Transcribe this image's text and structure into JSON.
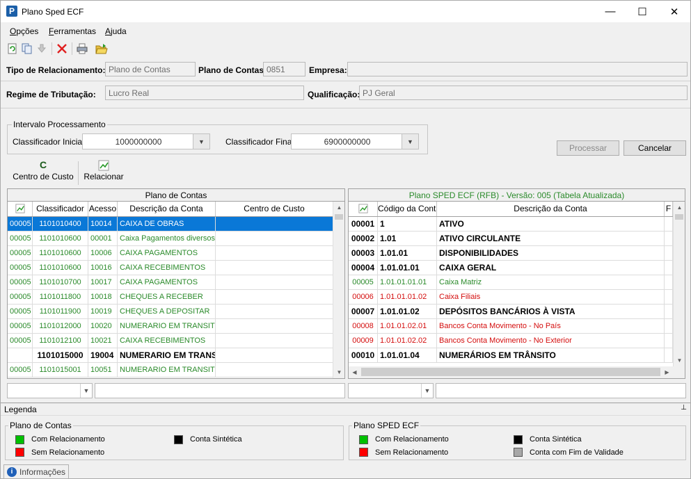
{
  "window": {
    "title": "Plano Sped ECF",
    "app_icon_letter": "P",
    "minimize": "—",
    "maximize": "☐",
    "close": "✕"
  },
  "menu": [
    {
      "label": "Opções",
      "underline": "O",
      "rest": "pções"
    },
    {
      "label": "Ferramentas",
      "underline": "F",
      "rest": "erramentas"
    },
    {
      "label": "Ajuda",
      "underline": "A",
      "rest": "juda"
    }
  ],
  "form": {
    "tipo_label": "Tipo de Relacionamento:",
    "tipo_value": "Plano de Contas",
    "plano_label": "Plano de Contas:",
    "plano_value": "0851",
    "empresa_label": "Empresa:",
    "empresa_value": "",
    "regime_label": "Regime de Tributação:",
    "regime_value": "Lucro Real",
    "qualificacao_label": "Qualificação:",
    "qualificacao_value": "PJ Geral"
  },
  "intervalo": {
    "title": "Intervalo Processamento",
    "inicial_label": "Classificador Inicial:",
    "inicial_value": "1000000000",
    "final_label": "Classificador Final:",
    "final_value": "6900000000"
  },
  "buttons": {
    "processar": "Processar",
    "cancelar": "Cancelar",
    "centro_custo": "Centro de Custo",
    "centro_custo_icon_letter": "C",
    "relacionar": "Relacionar"
  },
  "left_grid": {
    "caption": "Plano de Contas",
    "headers": [
      "",
      "Classificador",
      "Acesso",
      "Descrição da Conta",
      "Centro de Custo"
    ],
    "rows": [
      {
        "style": "sel",
        "code": "00005",
        "classificador": "1101010400",
        "acesso": "10014",
        "descricao": "CAIXA DE OBRAS",
        "centro": ""
      },
      {
        "style": "green",
        "code": "00005",
        "classificador": "1101010600",
        "acesso": "00001",
        "descricao": "Caixa Pagamentos diversos",
        "centro": ""
      },
      {
        "style": "green",
        "code": "00005",
        "classificador": "1101010600",
        "acesso": "10006",
        "descricao": "CAIXA PAGAMENTOS",
        "centro": ""
      },
      {
        "style": "green",
        "code": "00005",
        "classificador": "1101010600",
        "acesso": "10016",
        "descricao": "CAIXA RECEBIMENTOS",
        "centro": ""
      },
      {
        "style": "green",
        "code": "00005",
        "classificador": "1101010700",
        "acesso": "10017",
        "descricao": "CAIXA PAGAMENTOS",
        "centro": ""
      },
      {
        "style": "green",
        "code": "00005",
        "classificador": "1101011800",
        "acesso": "10018",
        "descricao": "CHEQUES A RECEBER",
        "centro": ""
      },
      {
        "style": "green",
        "code": "00005",
        "classificador": "1101011900",
        "acesso": "10019",
        "descricao": "CHEQUES A DEPOSITAR",
        "centro": ""
      },
      {
        "style": "green",
        "code": "00005",
        "classificador": "1101012000",
        "acesso": "10020",
        "descricao": "NUMERARIO EM TRANSITO",
        "centro": ""
      },
      {
        "style": "green",
        "code": "00005",
        "classificador": "1101012100",
        "acesso": "10021",
        "descricao": "CAIXA RECEBIMENTOS",
        "centro": ""
      },
      {
        "style": "bold",
        "code": "",
        "classificador": "1101015000",
        "acesso": "19004",
        "descricao": "NUMERARIO EM TRANSIT",
        "centro": ""
      },
      {
        "style": "green",
        "code": "00005",
        "classificador": "1101015001",
        "acesso": "10051",
        "descricao": "NUMERARIO EM TRANSITO",
        "centro": ""
      }
    ]
  },
  "right_grid": {
    "caption": "Plano SPED ECF (RFB) - Versão: 005 (Tabela Atualizada)",
    "caption_color": "#2a8a2a",
    "headers": [
      "",
      "Código da Conta",
      "Descrição da Conta",
      "F"
    ],
    "rows": [
      {
        "style": "bold",
        "code": "00001",
        "codigo": "1",
        "descricao": "ATIVO"
      },
      {
        "style": "bold",
        "code": "00002",
        "codigo": "1.01",
        "descricao": "ATIVO CIRCULANTE"
      },
      {
        "style": "bold",
        "code": "00003",
        "codigo": "1.01.01",
        "descricao": "DISPONIBILIDADES"
      },
      {
        "style": "bold",
        "code": "00004",
        "codigo": "1.01.01.01",
        "descricao": "CAIXA GERAL"
      },
      {
        "style": "green",
        "code": "00005",
        "codigo": "1.01.01.01.01",
        "descricao": "Caixa Matriz"
      },
      {
        "style": "red",
        "code": "00006",
        "codigo": "1.01.01.01.02",
        "descricao": "Caixa Filiais"
      },
      {
        "style": "bold",
        "code": "00007",
        "codigo": "1.01.01.02",
        "descricao": "DEPÓSITOS BANCÁRIOS À VISTA"
      },
      {
        "style": "red",
        "code": "00008",
        "codigo": "1.01.01.02.01",
        "descricao": "Bancos Conta Movimento - No País"
      },
      {
        "style": "red",
        "code": "00009",
        "codigo": "1.01.01.02.02",
        "descricao": "Bancos Conta Movimento - No Exterior"
      },
      {
        "style": "bold",
        "code": "00010",
        "codigo": "1.01.01.04",
        "descricao": "NUMERÁRIOS EM TRÂNSITO"
      }
    ]
  },
  "legenda": {
    "title": "Legenda",
    "pin_icon": "📌",
    "plano_contas": {
      "title": "Plano de Contas",
      "com": "Com Relacionamento",
      "sem": "Sem Relacionamento",
      "sintetica": "Conta Sintética"
    },
    "plano_sped": {
      "title": "Plano SPED ECF",
      "com": "Com Relacionamento",
      "sem": "Sem Relacionamento",
      "sintetica": "Conta Sintética",
      "fim_validade": "Conta com Fim de Validade"
    },
    "colors": {
      "green": "#00c000",
      "red": "#ff0000",
      "black": "#000000",
      "gray": "#a8a8a8"
    }
  },
  "statusbar": {
    "info_tab": "Informações",
    "info_icon": "i"
  }
}
